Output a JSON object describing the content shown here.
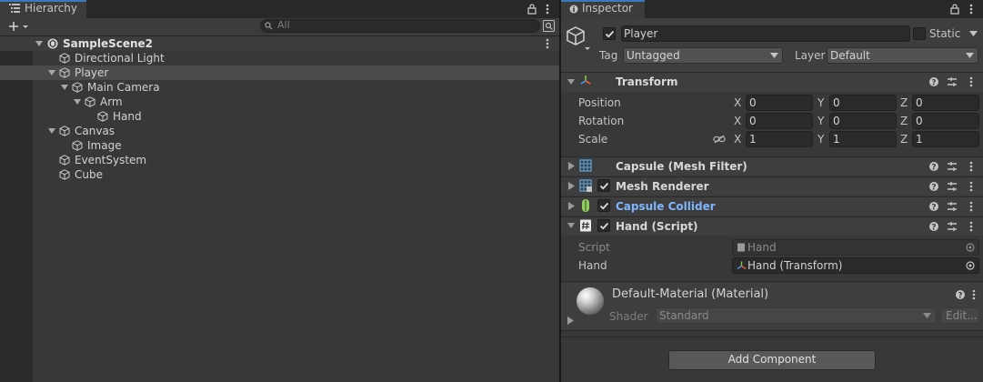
{
  "hierarchy": {
    "tab_label": "Hierarchy",
    "search_placeholder": "All",
    "scene_name": "SampleScene2",
    "items": [
      {
        "label": "Directional Light"
      },
      {
        "label": "Player"
      },
      {
        "label": "Main Camera"
      },
      {
        "label": "Arm"
      },
      {
        "label": "Hand"
      },
      {
        "label": "Canvas"
      },
      {
        "label": "Image"
      },
      {
        "label": "EventSystem"
      },
      {
        "label": "Cube"
      }
    ]
  },
  "inspector": {
    "tab_label": "Inspector",
    "object_name": "Player",
    "active": true,
    "static_label": "Static",
    "tag_label": "Tag",
    "tag_value": "Untagged",
    "layer_label": "Layer",
    "layer_value": "Default",
    "transform": {
      "title": "Transform",
      "position_label": "Position",
      "rotation_label": "Rotation",
      "scale_label": "Scale",
      "x_label": "X",
      "y_label": "Y",
      "z_label": "Z",
      "position": [
        "0",
        "0",
        "0"
      ],
      "rotation": [
        "0",
        "0",
        "0"
      ],
      "scale": [
        "1",
        "1",
        "1"
      ]
    },
    "mesh_filter": {
      "title": "Capsule (Mesh Filter)"
    },
    "mesh_renderer": {
      "title": "Mesh Renderer",
      "enabled": true
    },
    "capsule_collider": {
      "title": "Capsule Collider",
      "enabled": true,
      "color": "#7fb6ff"
    },
    "hand_script": {
      "title": "Hand (Script)",
      "enabled": true,
      "script_label": "Script",
      "script_value": "Hand",
      "hand_label": "Hand",
      "hand_value": "Hand (Transform)"
    },
    "material": {
      "title": "Default-Material (Material)",
      "shader_label": "Shader",
      "shader_value": "Standard",
      "edit_label": "Edit..."
    },
    "add_component_label": "Add Component"
  },
  "colors": {
    "accent": "#3a79bb",
    "panel": "#383838",
    "header": "#3e3e3e"
  }
}
